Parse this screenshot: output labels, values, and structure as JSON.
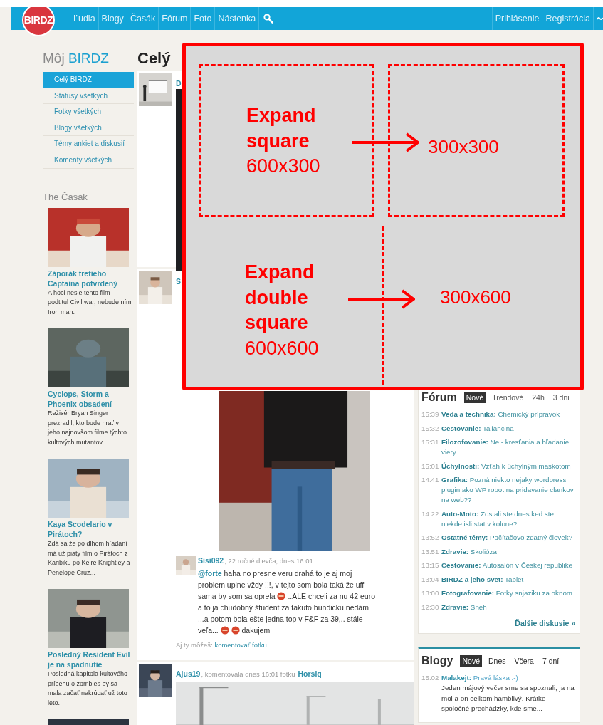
{
  "nav": {
    "logo": "BIRDZ",
    "links": [
      {
        "label": "Ľudia"
      },
      {
        "label": "Blogy"
      },
      {
        "label": "Časák"
      },
      {
        "label": "Fórum"
      },
      {
        "label": "Foto"
      },
      {
        "label": "Nástenka"
      }
    ],
    "account": [
      {
        "label": "Prihlásenie"
      },
      {
        "label": "Registrácia"
      }
    ]
  },
  "sidebar": {
    "title": "Môj",
    "brand": "BIRDZ",
    "items": [
      {
        "label": "Celý BIRDZ",
        "selected": true
      },
      {
        "label": "Statusy všetkých",
        "selected": false
      },
      {
        "label": "Fotky všetkých",
        "selected": false
      },
      {
        "label": "Blogy všetkých",
        "selected": false
      },
      {
        "label": "Témy ankiet a diskusií",
        "selected": false
      },
      {
        "label": "Komenty všetkých",
        "selected": false
      }
    ]
  },
  "casak": {
    "title": "The Časák",
    "articles": [
      {
        "title": "Záporák tretieho Captaina potvrdený",
        "text": "A hoci nesie tento film podtitul Civil war, nebude ním Iron man."
      },
      {
        "title": "Cyclops, Storm a Phoenix obsadení",
        "text": "Režisér Bryan Singer prezradil, kto bude hrať v jeho najnovšom filme týchto kultových mutantov."
      },
      {
        "title": "Kaya Scodelario v Pirátoch?",
        "text": "Zdá sa že po dlhom hľadaní má už piaty film o Pirátoch z Karibiku po Keire Knightley a Penelope Cruz..."
      },
      {
        "title": "Posledný Resident Evil je na spadnutie",
        "text": "Posledná kapitola kultového príbehu o zombies by sa mala začať nakrúcať už toto leto."
      },
      {
        "kind": "picture"
      }
    ]
  },
  "feed": {
    "title": "Celý",
    "posts": [
      {
        "kind": "video",
        "author": "D"
      },
      {
        "author": "S",
        "comment": {
          "author": "Sisi092",
          "meta": ", 22 ročné dievča, dnes 16:01",
          "mention": "@forte",
          "parts": [
            {
              "kind": "text",
              "text": "haha no presne veru drahá to je aj moj problem uplne vždy !!!, v tejto som bola taká že uff sama by som sa oprela"
            },
            {
              "kind": "emoji"
            },
            {
              "kind": "text",
              "text": "..ALE chceli za nu 42 euro a to ja chudobný študent za takuto bundicku nedám ...a potom bola ešte jedna top v F&F za 39,.. stále veľa..."
            },
            {
              "kind": "emoji"
            },
            {
              "kind": "emoji"
            },
            {
              "kind": "text",
              "text": "dakujem"
            }
          ]
        },
        "prompt": "Aj ty môžeš:",
        "action": "komentovať fotku"
      },
      {
        "kind": "activity",
        "author": "Ajus19",
        "meta": ", komentovala dnes 16:01 fotku",
        "target": "Horsiq"
      }
    ]
  },
  "forum": {
    "title": "Fórum",
    "tabs": [
      {
        "label": "Nové",
        "selected": true
      },
      {
        "label": "Trendové",
        "selected": false
      },
      {
        "label": "24h",
        "selected": false
      },
      {
        "label": "3 dni",
        "selected": false
      }
    ],
    "items": [
      {
        "time": "15:39",
        "category": "Veda a technika:",
        "topic": "Chemický prípravok"
      },
      {
        "time": "15:32",
        "category": "Cestovanie:",
        "topic": "Taliancina"
      },
      {
        "time": "15:31",
        "category": "Filozofovanie:",
        "topic": "Ne - kresťania a hľadanie viery"
      },
      {
        "time": "15:01",
        "category": "Úchylnosti:",
        "topic": "Vzťah k úchylným maskotom"
      },
      {
        "time": "14:41",
        "category": "Grafika:",
        "topic": "Pozná niekto nejaky wordpress plugin ako WP robot na pridavanie clankov na web??"
      },
      {
        "time": "14:22",
        "category": "Auto-Moto:",
        "topic": "Zostali ste dnes ked ste niekde isli stat v kolone?"
      },
      {
        "time": "13:52",
        "category": "Ostatné témy:",
        "topic": "Počítačovo zdatný človek?"
      },
      {
        "time": "13:51",
        "category": "Zdravie:",
        "topic": "Skolióza"
      },
      {
        "time": "13:15",
        "category": "Cestovanie:",
        "topic": "Autosalón v Českej republike"
      },
      {
        "time": "13:04",
        "category": "BIRDZ a jeho svet:",
        "topic": "Tablet"
      },
      {
        "time": "13:00",
        "category": "Fotografovanie:",
        "topic": "Fotky snjaziku za oknom"
      },
      {
        "time": "12:30",
        "category": "Zdravie:",
        "topic": "Sneh"
      }
    ],
    "more": "Ďalšie diskusie »"
  },
  "blogs": {
    "title": "Blogy",
    "tabs": [
      {
        "label": "Nové",
        "selected": true
      },
      {
        "label": "Dnes",
        "selected": false
      },
      {
        "label": "Včera",
        "selected": false
      },
      {
        "label": "7 dní",
        "selected": false
      }
    ],
    "items": [
      {
        "time": "15:02",
        "author": "Malakejt:",
        "title": "Pravá láska :-)",
        "excerpt": "Jeden májový večer sme sa spoznali, ja na mol a on celkom hamblivý. Krátke spoločné prechádzky, kde sme..."
      }
    ]
  },
  "annotation": {
    "areas": [
      {
        "title": "Expand square",
        "size": "600x300",
        "result": "300x300"
      },
      {
        "title": "Expand double square",
        "size": "600x600",
        "result": "300x600"
      }
    ]
  }
}
